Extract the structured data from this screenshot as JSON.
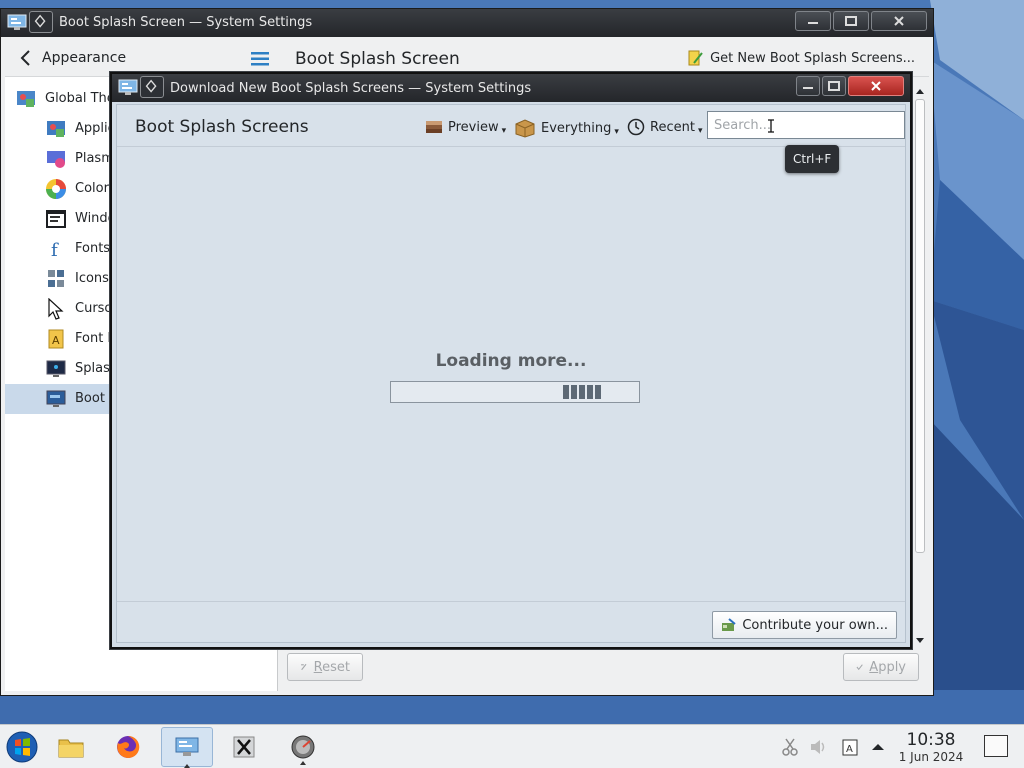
{
  "main_window": {
    "title": "Boot Splash Screen — System Settings",
    "sidebar": {
      "header": "Appearance",
      "items": [
        {
          "label": "Global The",
          "icon": "global-theme-icon"
        },
        {
          "label": "Applic",
          "icon": "application-style-icon"
        },
        {
          "label": "Plasm",
          "icon": "plasma-style-icon"
        },
        {
          "label": "Colors",
          "icon": "colors-icon"
        },
        {
          "label": "Windo",
          "icon": "window-decorations-icon"
        },
        {
          "label": "Fonts",
          "icon": "fonts-icon"
        },
        {
          "label": "Icons",
          "icon": "icons-icon"
        },
        {
          "label": "Curso",
          "icon": "cursors-icon"
        },
        {
          "label": "Font M",
          "icon": "font-management-icon"
        },
        {
          "label": "Splash",
          "icon": "splash-screen-icon"
        },
        {
          "label": "Boot S",
          "icon": "boot-splash-icon",
          "selected": true
        }
      ]
    },
    "page_title": "Boot Splash Screen",
    "get_new_label": "Get New Boot Splash Screens...",
    "reset_label": "Reset",
    "apply_label": "Apply"
  },
  "dialog": {
    "title": "Download New Boot Splash Screens — System Settings",
    "heading": "Boot Splash Screens",
    "preview_label": "Preview",
    "everything_label": "Everything",
    "recent_label": "Recent",
    "search_placeholder": "Search...",
    "tooltip": "Ctrl+F",
    "loading_text": "Loading more...",
    "contribute_label": "Contribute your own..."
  },
  "taskbar": {
    "apps": [
      "start-menu-icon",
      "file-manager-icon",
      "firefox-icon",
      "system-settings-icon",
      "x-app-icon",
      "disk-utility-icon"
    ],
    "clock_time": "10:38",
    "clock_date": "1 Jun 2024"
  },
  "colors": {
    "accent": "#3daee9",
    "selection": "#c9d9ea",
    "titlebar": "#2a2d31"
  }
}
